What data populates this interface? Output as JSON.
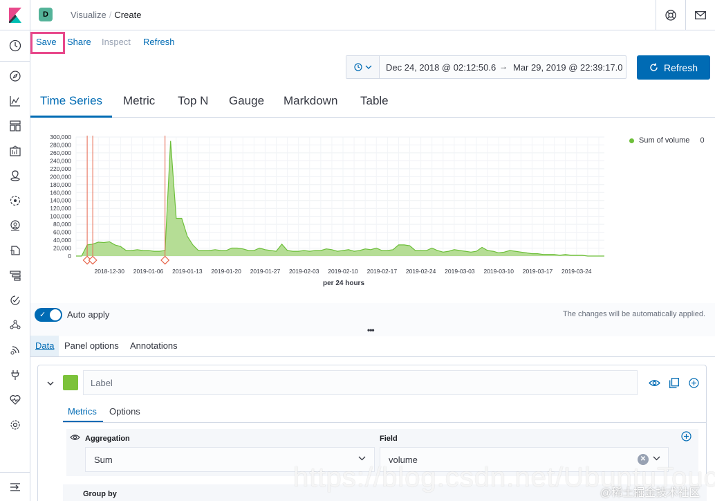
{
  "header": {
    "space_initial": "D",
    "breadcrumb": [
      "Visualize",
      "Create"
    ]
  },
  "toplinks": {
    "save": "Save",
    "share": "Share",
    "inspect": "Inspect",
    "refresh": "Refresh"
  },
  "timepicker": {
    "start": "Dec 24, 2018 @ 02:12:50.6",
    "arrow": "→",
    "end": "Mar 29, 2019 @ 22:39:17.0",
    "refresh_label": "Refresh"
  },
  "vis_tabs": [
    "Time Series",
    "Metric",
    "Top N",
    "Gauge",
    "Markdown",
    "Table"
  ],
  "chart_data": {
    "type": "area",
    "xlabel": "per 24 hours",
    "ylim": [
      0,
      300000
    ],
    "y_ticks": [
      "300,000",
      "280,000",
      "260,000",
      "240,000",
      "220,000",
      "200,000",
      "180,000",
      "160,000",
      "140,000",
      "120,000",
      "100,000",
      "80,000",
      "60,000",
      "40,000",
      "20,000",
      "0"
    ],
    "x_ticks": [
      "2018-12-30",
      "2019-01-06",
      "2019-01-13",
      "2019-01-20",
      "2019-01-27",
      "2019-02-03",
      "2019-02-10",
      "2019-02-17",
      "2019-02-24",
      "2019-03-03",
      "2019-03-10",
      "2019-03-17",
      "2019-03-24"
    ],
    "series": [
      {
        "name": "Sum of volume",
        "legend_value": "0",
        "color": "#6dbf3a",
        "x_start": "2018-12-24",
        "values": [
          0,
          0,
          28000,
          30000,
          35000,
          34000,
          36000,
          28000,
          24000,
          14000,
          14000,
          16000,
          14000,
          14000,
          12000,
          12000,
          14000,
          290000,
          95000,
          95000,
          50000,
          28000,
          14000,
          14000,
          14000,
          16000,
          14000,
          14000,
          20000,
          20000,
          18000,
          14000,
          14000,
          20000,
          16000,
          14000,
          12000,
          30000,
          14000,
          12000,
          12000,
          14000,
          12000,
          14000,
          14000,
          18000,
          16000,
          12000,
          14000,
          16000,
          12000,
          14000,
          18000,
          16000,
          20000,
          14000,
          14000,
          16000,
          28000,
          28000,
          26000,
          14000,
          14000,
          14000,
          20000,
          14000,
          10000,
          12000,
          16000,
          14000,
          12000,
          10000,
          12000,
          22000,
          14000,
          12000,
          8000,
          10000,
          14000,
          12000,
          10000,
          8000,
          6000,
          6000,
          4000,
          4000,
          4000,
          2000,
          4000,
          2000,
          2000,
          2000,
          0,
          0,
          0,
          0
        ]
      }
    ],
    "annotation_dates": [
      "2018-12-26",
      "2018-12-27",
      "2019-01-09"
    ],
    "legend_position": "top-right",
    "grid": true
  },
  "auto_apply": {
    "label": "Auto apply",
    "note": "The changes will be automatically applied.",
    "enabled": true
  },
  "editor_tabs": [
    "Data",
    "Panel options",
    "Annotations"
  ],
  "series_panel": {
    "label_placeholder": "Label",
    "swatch_color": "#7cc23a",
    "tabs": [
      "Metrics",
      "Options"
    ],
    "aggregation_label": "Aggregation",
    "aggregation_value": "Sum",
    "field_label": "Field",
    "field_value": "volume",
    "group_by_label": "Group by"
  },
  "watermark": "https://blog.csdn.net/UbuntuTouch",
  "watermark2": "@稀土掘金技术社区"
}
